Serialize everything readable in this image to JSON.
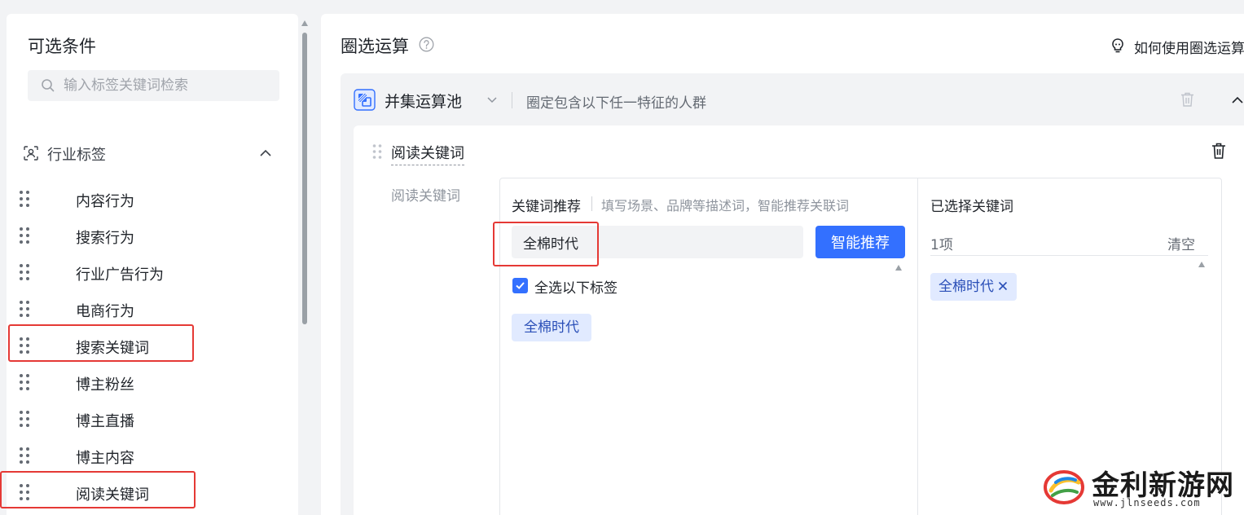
{
  "left": {
    "title": "可选条件",
    "search_placeholder": "输入标签关键词检索",
    "section_label": "行业标签",
    "items": [
      {
        "label": "内容行为"
      },
      {
        "label": "搜索行为"
      },
      {
        "label": "行业广告行为"
      },
      {
        "label": "电商行为"
      },
      {
        "label": "搜索关键词"
      },
      {
        "label": "博主粉丝"
      },
      {
        "label": "博主直播"
      },
      {
        "label": "博主内容"
      },
      {
        "label": "阅读关键词"
      }
    ]
  },
  "right": {
    "title": "圈选运算",
    "howto_label": "如何使用圈选运算",
    "pool": {
      "name": "并集运算池",
      "description": "圈定包含以下任一特征的人群"
    },
    "condition": {
      "title": "阅读关键词",
      "field_label": "阅读关键词",
      "recommend": {
        "label": "关键词推荐",
        "hint": "填写场景、品牌等描述词，智能推荐关联词",
        "input_value": "全棉时代",
        "button_label": "智能推荐",
        "select_all_label": "全选以下标签",
        "tag": "全棉时代"
      },
      "selected": {
        "label": "已选择关键词",
        "count": "1项",
        "clear_label": "清空",
        "tag": "全棉时代"
      }
    }
  },
  "watermark": {
    "name": "金利新游网",
    "url": "www.jlnseeds.com"
  },
  "colors": {
    "primary": "#3370ff",
    "highlight": "#e53935",
    "tag_bg": "#e1eaff",
    "tag_text": "#2a4fb7"
  }
}
